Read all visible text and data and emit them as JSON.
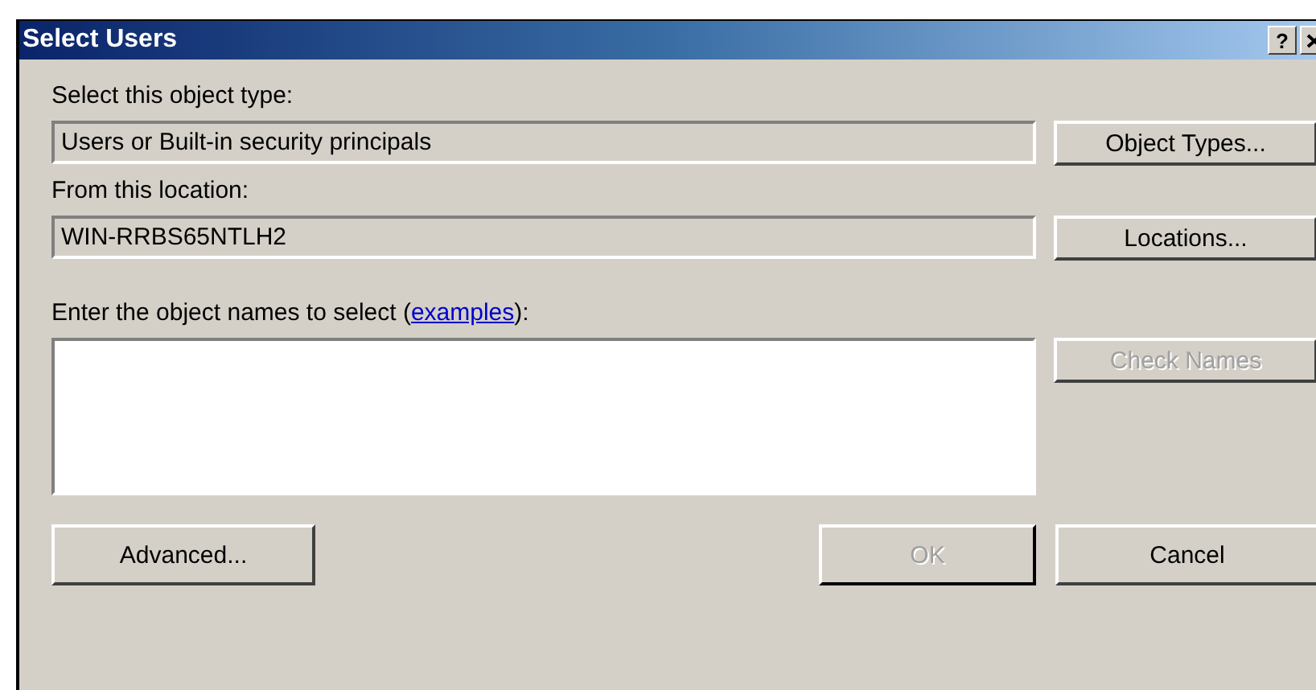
{
  "window": {
    "title": "Select Users",
    "help_button": "?"
  },
  "object_type": {
    "label": "Select this object type:",
    "value": "Users or Built-in security principals",
    "button": "Object Types..."
  },
  "location": {
    "label": "From this location:",
    "value": "WIN-RRBS65NTLH2",
    "button": "Locations..."
  },
  "names": {
    "label_before": "Enter the object names to select (",
    "link": "examples",
    "label_after": "):",
    "button": "Check Names",
    "button_disabled": true
  },
  "buttons": [
    {
      "label": "Advanced...",
      "disabled": false
    },
    {
      "label": "OK",
      "disabled": true
    },
    {
      "label": "Cancel",
      "disabled": false
    }
  ]
}
